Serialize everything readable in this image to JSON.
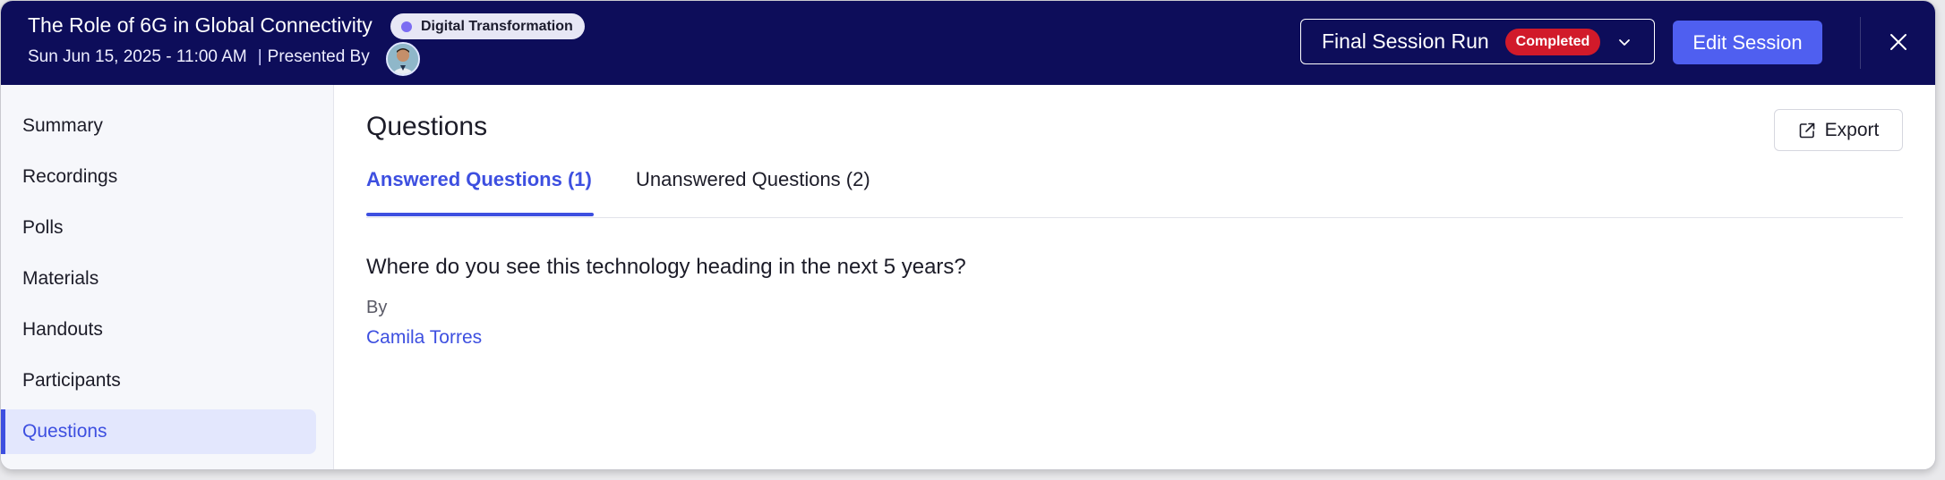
{
  "header": {
    "title": "The Role of 6G in Global Connectivity",
    "tag": "Digital Transformation",
    "datetime": "Sun Jun 15, 2025 - 11:00 AM",
    "separator": "|",
    "presented_by": "Presented By",
    "session_select": {
      "value": "Final Session Run",
      "status": "Completed"
    },
    "edit_button": "Edit Session"
  },
  "sidebar": {
    "items": [
      {
        "label": "Summary"
      },
      {
        "label": "Recordings"
      },
      {
        "label": "Polls"
      },
      {
        "label": "Materials"
      },
      {
        "label": "Handouts"
      },
      {
        "label": "Participants"
      },
      {
        "label": "Questions"
      }
    ],
    "active_index": 6
  },
  "main": {
    "title": "Questions",
    "export_button": "Export",
    "tabs": [
      {
        "label": "Answered Questions (1)"
      },
      {
        "label": "Unanswered Questions (2)"
      }
    ],
    "question": {
      "text": "Where do you see this technology heading in the next 5 years?",
      "by_label": "By",
      "author": "Camila Torres"
    }
  },
  "colors": {
    "header_bg": "#0d0d5a",
    "accent": "#3d4fe0",
    "primary_button": "#4f5ff0",
    "status_completed": "#d11a2a",
    "tag_dot": "#7b6cf2"
  },
  "icons": {
    "chevron": "chevron-down-icon",
    "close": "close-icon",
    "export": "export-icon",
    "tag": "dot-icon"
  }
}
